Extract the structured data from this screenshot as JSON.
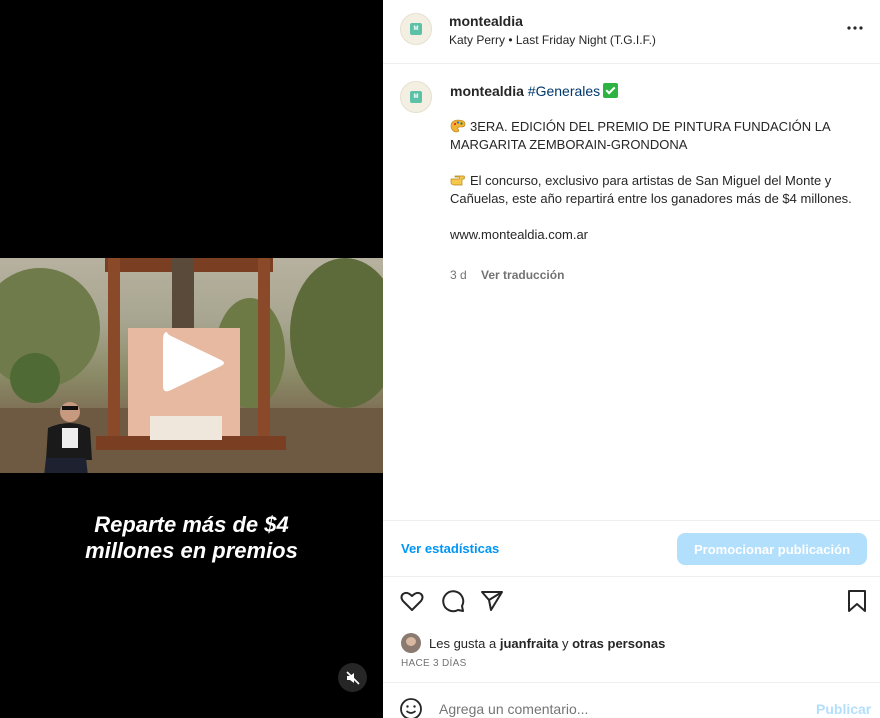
{
  "header": {
    "username": "montealdia",
    "audio": "Katy Perry • Last Friday Night (T.G.I.F.)",
    "more_icon": "more-horizontal-icon"
  },
  "caption": {
    "username": "montealdia",
    "hashtag": "#Generales",
    "para1": "3ERA. EDICIÓN DEL PREMIO DE PINTURA FUNDACIÓN LA MARGARITA ZEMBORAIN-GRONDONA",
    "para2": "El concurso, exclusivo para artistas de San Miguel del Monte y Cañuelas, este año repartirá entre los ganadores más de $4 millones.",
    "url": "www.montealdia.com.ar",
    "time": "3 d",
    "translate": "Ver traducción"
  },
  "video": {
    "overlay_line1": "Reparte más de $4",
    "overlay_line2": "millones en premios"
  },
  "stats": {
    "view_stats": "Ver estadísticas",
    "promote": "Promocionar publicación"
  },
  "likes": {
    "prefix": "Les gusta a ",
    "user": "juanfraita",
    "middle": " y ",
    "others": "otras personas"
  },
  "posted_ago": "HACE 3 DÍAS",
  "comment": {
    "placeholder": "Agrega un comentario...",
    "publish": "Publicar"
  },
  "colors": {
    "accent": "#0095f6",
    "accent_disabled": "#b2dffc",
    "check_green": "#2db342"
  }
}
